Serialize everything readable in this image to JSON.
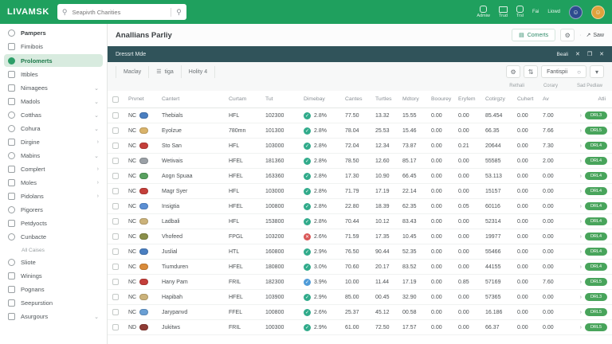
{
  "colors": {
    "topbar_green": "#1fa05e",
    "teal_bar": "#30535a",
    "active_sidebar_bg": "#d8ebdf",
    "badge_green": "#48a45b",
    "status_ok": "#31ab8b",
    "status_err": "#d95757",
    "status_info": "#4f9bd8"
  },
  "topbar": {
    "logo": "LIVAMSK",
    "search": {
      "placeholder": "Seapivth Charities",
      "icon": "search-icon"
    },
    "nav": [
      {
        "label": "Admiw",
        "icon": "window-icon"
      },
      {
        "label": "Trud",
        "icon": "monitor-icon"
      },
      {
        "label": "Trsl",
        "icon": "person-icon"
      }
    ],
    "texts": [
      "Fai",
      "Liowd"
    ],
    "avatars": [
      "avatar-dark",
      "avatar-orange"
    ]
  },
  "sidebar": {
    "items": [
      {
        "label": "Pampers",
        "icon": "circle",
        "bold": true,
        "chev": "",
        "search": true
      },
      {
        "label": "Fimibois",
        "icon": "square",
        "chev": ""
      },
      {
        "label": "Prolomerts",
        "icon": "fill",
        "chev": "",
        "active": true
      },
      {
        "label": "Ittibles",
        "icon": "square",
        "chev": ""
      },
      {
        "label": "Nimagees",
        "icon": "square",
        "chev": "v"
      },
      {
        "label": "Madols",
        "icon": "square",
        "chev": "v"
      },
      {
        "label": "Cotthas",
        "icon": "circle",
        "chev": "v"
      },
      {
        "label": "Cohura",
        "icon": "circle",
        "chev": "v"
      },
      {
        "label": "Dirgine",
        "icon": "square",
        "chev": ">"
      },
      {
        "label": "Mabins",
        "icon": "circle",
        "chev": "v"
      },
      {
        "label": "Complert",
        "icon": "square",
        "chev": ">"
      },
      {
        "label": "Moles",
        "icon": "square",
        "chev": ">"
      },
      {
        "label": "Pidolans",
        "icon": "square",
        "chev": ">"
      },
      {
        "label": "Pigorers",
        "icon": "circle",
        "chev": ""
      },
      {
        "label": "Petdyocts",
        "icon": "square",
        "chev": ""
      },
      {
        "label": "Cunbacte",
        "icon": "circle",
        "chev": ""
      },
      {
        "section": "All Caises"
      },
      {
        "label": "Sliote",
        "icon": "circle",
        "chev": ""
      },
      {
        "label": "Winings",
        "icon": "square",
        "chev": ""
      },
      {
        "label": "Pognans",
        "icon": "square",
        "chev": ""
      },
      {
        "label": "Seepurstion",
        "icon": "square",
        "chev": ""
      },
      {
        "label": "Asurgours",
        "icon": "square",
        "chev": "v"
      }
    ]
  },
  "header": {
    "title": "Anallians Parliy",
    "comments_label": "Comerts",
    "save_label": "Saw"
  },
  "panel": {
    "title": "Dressrt Mde",
    "right_label": "Beali"
  },
  "toolbar": {
    "segments": [
      "Maclay",
      "tiga",
      "Holity 4"
    ],
    "dropdown_value": "Fantispii",
    "mini_labels": [
      "Rethali",
      "Corary",
      "Sad Pedlaw"
    ]
  },
  "table": {
    "columns": [
      "Prvnet",
      "Cantert",
      "Curtam",
      "Tut",
      "Dimebay",
      "Cantes",
      "Turtles",
      "Mdtory",
      "Boourey",
      "Eryfem",
      "Cotirgzy",
      "Cuhert",
      "Av",
      "Atli"
    ],
    "rows": [
      {
        "country": "NC",
        "flag": "#4a7fc1",
        "name": "Thebials",
        "type": "HFL",
        "num": "102300",
        "status": "ok",
        "pct": "2.8%",
        "values": [
          "77.50",
          "13.32",
          "15.55",
          "0.00",
          "0.00",
          "85.454",
          "0.00",
          "7.00"
        ],
        "badge": "DRL3"
      },
      {
        "country": "NC",
        "flag": "#d9b36a",
        "name": "Eyolzue",
        "type": "780mn",
        "num": "101300",
        "status": "ok",
        "pct": "2.8%",
        "values": [
          "78.04",
          "25.53",
          "15.46",
          "0.00",
          "0.00",
          "66.35",
          "0.00",
          "7.66"
        ],
        "badge": "DRL5"
      },
      {
        "country": "NC",
        "flag": "#c43f3a",
        "name": "Sto San",
        "type": "HFL",
        "num": "103000",
        "status": "ok",
        "pct": "2.8%",
        "values": [
          "72.04",
          "12.34",
          "73.87",
          "0.00",
          "0.21",
          "20644",
          "0.00",
          "7.30"
        ],
        "badge": "DRL4"
      },
      {
        "country": "NC",
        "flag": "#9aa0a6",
        "name": "Wetivais",
        "type": "HFEL",
        "num": "181360",
        "status": "ok",
        "pct": "2.8%",
        "values": [
          "78.50",
          "12.60",
          "85.17",
          "0.00",
          "0.00",
          "55585",
          "0.00",
          "2.00"
        ],
        "badge": "DRL4"
      },
      {
        "country": "NC",
        "flag": "#58a05f",
        "name": "Aogn Spuaa",
        "type": "HFEL",
        "num": "163360",
        "status": "ok",
        "pct": "2.8%",
        "values": [
          "17.30",
          "10.90",
          "66.45",
          "0.00",
          "0.00",
          "53.113",
          "0.00",
          "0.00"
        ],
        "badge": "DRL4"
      },
      {
        "country": "NC",
        "flag": "#c43f3a",
        "name": "Magr Syer",
        "type": "HFL",
        "num": "103000",
        "status": "ok",
        "pct": "2.8%",
        "values": [
          "71.79",
          "17.19",
          "22.14",
          "0.00",
          "0.00",
          "15157",
          "0.00",
          "0.00"
        ],
        "badge": "DRL4"
      },
      {
        "country": "NC",
        "flag": "#5b8fd4",
        "name": "Insigtia",
        "type": "HFEL",
        "num": "100800",
        "status": "ok",
        "pct": "2.8%",
        "values": [
          "22.80",
          "18.39",
          "62.35",
          "0.00",
          "0.05",
          "60116",
          "0.00",
          "0.00"
        ],
        "badge": "DRL4"
      },
      {
        "country": "NC",
        "flag": "#cbb27a",
        "name": "Ladbali",
        "type": "HFL",
        "num": "153800",
        "status": "ok",
        "pct": "2.8%",
        "values": [
          "70.44",
          "10.12",
          "83.43",
          "0.00",
          "0.00",
          "52314",
          "0.00",
          "0.00"
        ],
        "badge": "DRL4"
      },
      {
        "country": "NC",
        "flag": "#8a8f4a",
        "name": "Vhofeed",
        "type": "FPGL",
        "num": "103200",
        "status": "err",
        "pct": "2.6%",
        "values": [
          "71.59",
          "17.35",
          "10.45",
          "0.00",
          "0.00",
          "19977",
          "0.00",
          "0.00"
        ],
        "badge": "DRL4"
      },
      {
        "country": "NC",
        "flag": "#4a7fc1",
        "name": "Juslial",
        "type": "HTL",
        "num": "160800",
        "status": "ok",
        "pct": "2.9%",
        "values": [
          "76.50",
          "90.44",
          "52.35",
          "0.00",
          "0.00",
          "55466",
          "0.00",
          "0.00"
        ],
        "badge": "DRL4"
      },
      {
        "country": "NC",
        "flag": "#d98b3a",
        "name": "Tiumduren",
        "type": "HFEL",
        "num": "180800",
        "status": "ok",
        "pct": "3.0%",
        "values": [
          "70.60",
          "20.17",
          "83.52",
          "0.00",
          "0.00",
          "44155",
          "0.00",
          "0.00"
        ],
        "badge": "DRL4"
      },
      {
        "country": "NC",
        "flag": "#c43f3a",
        "name": "Hany Pam",
        "type": "FRIL",
        "num": "182300",
        "status": "info",
        "pct": "3.9%",
        "values": [
          "10.00",
          "11.44",
          "17.19",
          "0.00",
          "0.85",
          "57169",
          "0.00",
          "7.60"
        ],
        "badge": "DRL5"
      },
      {
        "country": "NC",
        "flag": "#cbb27a",
        "name": "Hapibah",
        "type": "HFEL",
        "num": "103900",
        "status": "ok",
        "pct": "2.9%",
        "values": [
          "85.00",
          "00.45",
          "32.90",
          "0.00",
          "0.00",
          "57365",
          "0.00",
          "0.00"
        ],
        "badge": "DRL3"
      },
      {
        "country": "NC",
        "flag": "#6a9fd4",
        "name": "Jarypanvd",
        "type": "FFEL",
        "num": "100800",
        "status": "ok",
        "pct": "2.6%",
        "values": [
          "25.37",
          "45.12",
          "00.58",
          "0.00",
          "0.00",
          "16.186",
          "0.00",
          "0.00"
        ],
        "badge": "DRL5"
      },
      {
        "country": "ND",
        "flag": "#8f3b35",
        "name": "Jukitws",
        "type": "FRIL",
        "num": "100300",
        "status": "ok",
        "pct": "2.9%",
        "values": [
          "61.00",
          "72.50",
          "17.57",
          "0.00",
          "0.00",
          "66.37",
          "0.00",
          "0.00"
        ],
        "badge": "DRL5"
      }
    ]
  }
}
